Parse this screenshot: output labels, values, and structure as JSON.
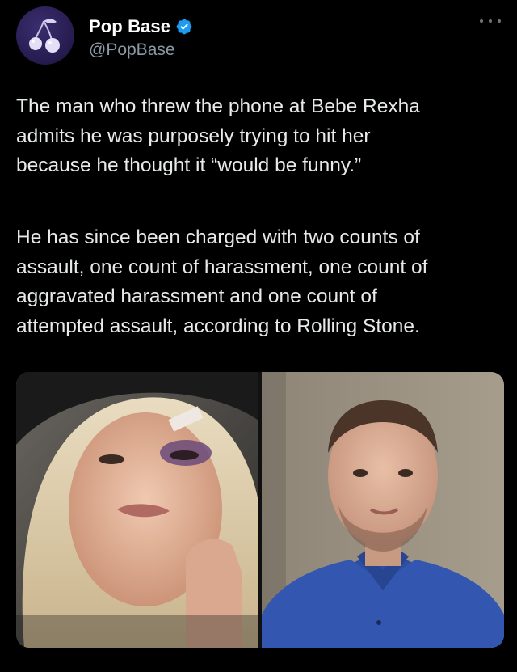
{
  "author": {
    "display_name": "Pop Base",
    "handle": "@PopBase",
    "verified": true,
    "avatar_icon": "cherries-logo-icon"
  },
  "menu_icon": "more-options-icon",
  "tweet": {
    "paragraph1": [
      "The man who threw the phone at Bebe Rexha",
      "admits he was purposely trying to hit her",
      "because he thought it “would be funny.”"
    ],
    "paragraph2": [
      "He has since been charged with two counts of",
      "assault, one count of harassment, one count of",
      "aggravated harassment and one count of",
      "attempted assault, according to Rolling Stone."
    ]
  },
  "media": {
    "image_count": 2
  },
  "colors": {
    "background": "#000000",
    "text": "#e7e9ea",
    "secondary_text": "#8b98a5",
    "verified_badge": "#1d9bf0"
  }
}
